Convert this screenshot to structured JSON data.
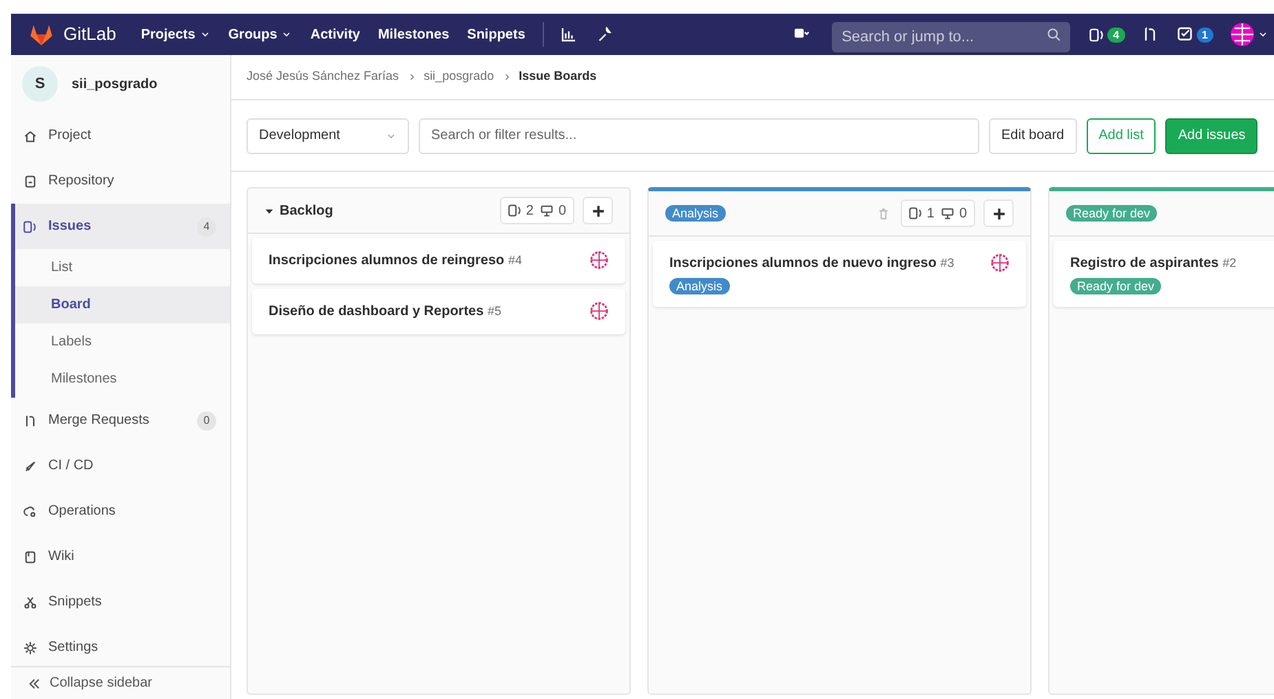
{
  "navbar": {
    "brand": "GitLab",
    "links": [
      {
        "label": "Projects",
        "dropdown": true
      },
      {
        "label": "Groups",
        "dropdown": true
      },
      {
        "label": "Activity",
        "dropdown": false
      },
      {
        "label": "Milestones",
        "dropdown": false
      },
      {
        "label": "Snippets",
        "dropdown": false
      }
    ],
    "search": {
      "placeholder": "Search or jump to..."
    },
    "issues_count": "4",
    "todos_count": "1"
  },
  "sidebar": {
    "avatar": "S",
    "project": "sii_posgrado",
    "items": [
      {
        "label": "Project",
        "selected": false
      },
      {
        "label": "Repository",
        "selected": false
      },
      {
        "label": "Issues",
        "selected": true,
        "count": "4",
        "children": [
          {
            "label": "List",
            "selected": false
          },
          {
            "label": "Board",
            "selected": true
          },
          {
            "label": "Labels",
            "selected": false
          },
          {
            "label": "Milestones",
            "selected": false
          }
        ]
      },
      {
        "label": "Merge Requests",
        "selected": false,
        "count": "0"
      },
      {
        "label": "CI / CD",
        "selected": false
      },
      {
        "label": "Operations",
        "selected": false
      },
      {
        "label": "Wiki",
        "selected": false
      },
      {
        "label": "Snippets",
        "selected": false
      },
      {
        "label": "Settings",
        "selected": false
      }
    ],
    "collapse": "Collapse sidebar"
  },
  "breadcrumb": [
    "José Jesús Sánchez Farías",
    "sii_posgrado",
    "Issue Boards"
  ],
  "toolbar": {
    "board": "Development",
    "filter_placeholder": "Search or filter results...",
    "buttons": [
      {
        "label": "Edit board",
        "kind": "default"
      },
      {
        "label": "Add list",
        "kind": "outline"
      },
      {
        "label": "Add issues",
        "kind": "primary"
      }
    ]
  },
  "lists": [
    {
      "kind": "plain",
      "title": "Backlog",
      "expanded": true,
      "deletable": false,
      "issue_count": "2",
      "weight": "0",
      "issues": [
        {
          "title": "Inscripciones alumnos de reingreso",
          "number": "#4"
        },
        {
          "title": "Diseño de dashboard y Reportes",
          "number": "#5"
        }
      ]
    },
    {
      "kind": "label",
      "title": "Analysis",
      "color": "#428bca",
      "deletable": true,
      "issue_count": "1",
      "weight": "0",
      "issues": [
        {
          "title": "Inscripciones alumnos de nuevo ingreso",
          "number": "#3",
          "labels": [
            {
              "text": "Analysis",
              "color": "#428bca"
            }
          ]
        }
      ]
    },
    {
      "kind": "label",
      "title": "Ready for dev",
      "color": "#44ad8e",
      "deletable": false,
      "issues": [
        {
          "title": "Registro de aspirantes",
          "number": "#2",
          "labels": [
            {
              "text": "Ready for dev",
              "color": "#44ad8e"
            }
          ]
        }
      ]
    }
  ]
}
